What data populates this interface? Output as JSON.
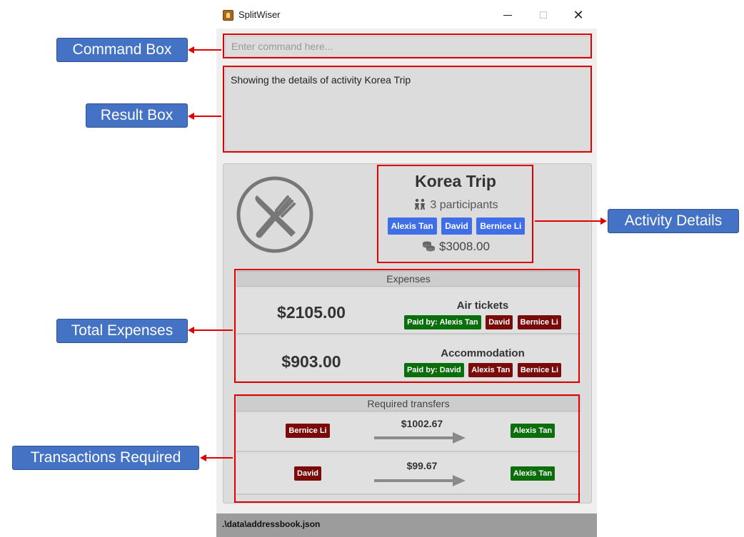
{
  "window": {
    "title": "SplitWiser"
  },
  "command_box": {
    "placeholder": "Enter command here..."
  },
  "result_box": {
    "text": "Showing the details of activity Korea Trip"
  },
  "activity": {
    "title": "Korea Trip",
    "participants_text": "3 participants",
    "participants": [
      "Alexis Tan",
      "David",
      "Bernice Li"
    ],
    "total_cost": "$3008.00"
  },
  "expenses": {
    "header": "Expenses",
    "items": [
      {
        "amount": "$2105.00",
        "title": "Air tickets",
        "paid_by": "Paid by: Alexis Tan",
        "involved": [
          "David",
          "Bernice Li"
        ]
      },
      {
        "amount": "$903.00",
        "title": "Accommodation",
        "paid_by": "Paid by: David",
        "involved": [
          "Alexis Tan",
          "Bernice Li"
        ]
      }
    ]
  },
  "transfers": {
    "header": "Required transfers",
    "items": [
      {
        "from": "Bernice Li",
        "amount": "$1002.67",
        "to": "Alexis Tan"
      },
      {
        "from": "David",
        "amount": "$99.67",
        "to": "Alexis Tan"
      }
    ]
  },
  "status_bar": {
    "path": ".\\data\\addressbook.json"
  },
  "callouts": {
    "command_box": "Command Box",
    "result_box": "Result Box",
    "activity_details": "Activity Details",
    "total_expenses": "Total Expenses",
    "transactions_required": "Transactions Required"
  },
  "colors": {
    "callout": "#4472c4",
    "frame": "#e00000",
    "participant_chip": "#3f6ee8",
    "payer_chip": "#0a6e0a",
    "debtor_chip": "#7b0a0a"
  },
  "icons": {
    "activity": "fork-knife-icon",
    "participants": "people-icon",
    "cost": "coins-icon",
    "transfer": "arrow-right-icon"
  }
}
